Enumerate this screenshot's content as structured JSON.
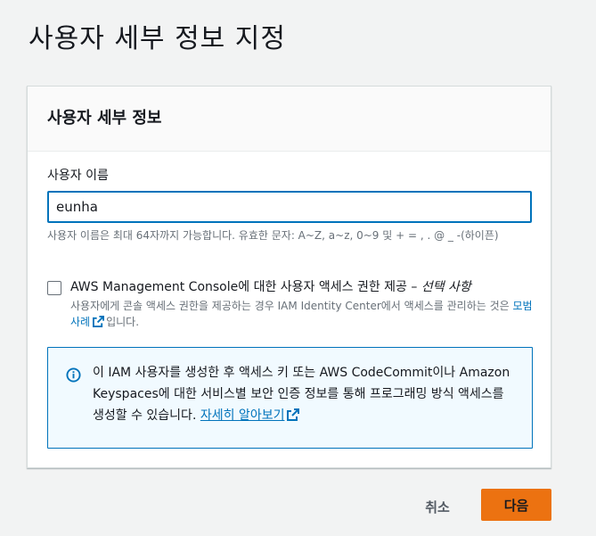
{
  "page": {
    "title": "사용자 세부 정보 지정"
  },
  "panel": {
    "title": "사용자 세부 정보",
    "username_label": "사용자 이름",
    "username_value": "eunha",
    "username_hint": "사용자 이름은 최대 64자까지 가능합니다. 유효한 문자: A~Z, a~z, 0~9 및 + = , . @ _ -(하이픈)",
    "console_access": {
      "checked": false,
      "label": "AWS Management Console에 대한 사용자 액세스 권한 제공 –",
      "label_optional": "선택 사항",
      "desc_before": "사용자에게 콘솔 액세스 권한을 제공하는 경우 IAM Identity Center에서 액세스를 관리하는 것은",
      "desc_link": "모범 사례",
      "desc_after": "입니다."
    },
    "info": {
      "text": "이 IAM 사용자를 생성한 후 액세스 키 또는 AWS CodeCommit이나 Amazon Keyspaces에 대한 서비스별 보안 인증 정보를 통해 프로그래밍 방식 액세스를 생성할 수 있습니다.",
      "link": "자세히 알아보기"
    }
  },
  "footer": {
    "cancel_label": "취소",
    "next_label": "다음"
  },
  "colors": {
    "accent": "#ec7211",
    "link": "#0073bb",
    "info_bg": "#f1faff"
  }
}
